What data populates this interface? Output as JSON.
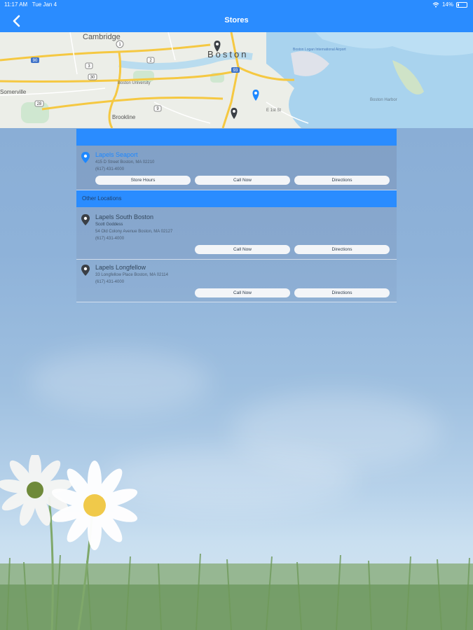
{
  "status_bar": {
    "time": "11:17 AM",
    "date": "Tue Jan 4",
    "battery": "14%"
  },
  "nav": {
    "title": "Stores"
  },
  "map": {
    "city_label": "Boston",
    "labels": [
      "Cambridge",
      "Boston University",
      "Brookline",
      "Somerville",
      "Boston Harbor",
      "E 1st St",
      "Boston Logan International Airport"
    ],
    "route_badges": [
      "90",
      "93",
      "1",
      "2",
      "3",
      "9",
      "30",
      "28"
    ]
  },
  "featured": {
    "name": "Lapels Seaport",
    "address": "415 D Street Boston, MA 02210",
    "phone": "(617) 431-4000",
    "buttons": {
      "hours": "Store Hours",
      "call": "Call Now",
      "directions": "Directions"
    }
  },
  "other_header": "Other Locations",
  "others": [
    {
      "name": "Lapels South Boston",
      "contact": "Scott Goddess",
      "address": "54 Old Colony Avenue Boston, MA 02127",
      "phone": "(617) 431-4000",
      "buttons": {
        "call": "Call Now",
        "directions": "Directions"
      }
    },
    {
      "name": "Lapels Longfellow",
      "address": "33 Longfellow Place Boston, MA 02114",
      "phone": "(617) 431-4000",
      "buttons": {
        "call": "Call Now",
        "directions": "Directions"
      }
    }
  ],
  "colors": {
    "accent": "#2a8cff",
    "pin_featured": "#1e88ff",
    "pin_other": "#3a3f45"
  }
}
